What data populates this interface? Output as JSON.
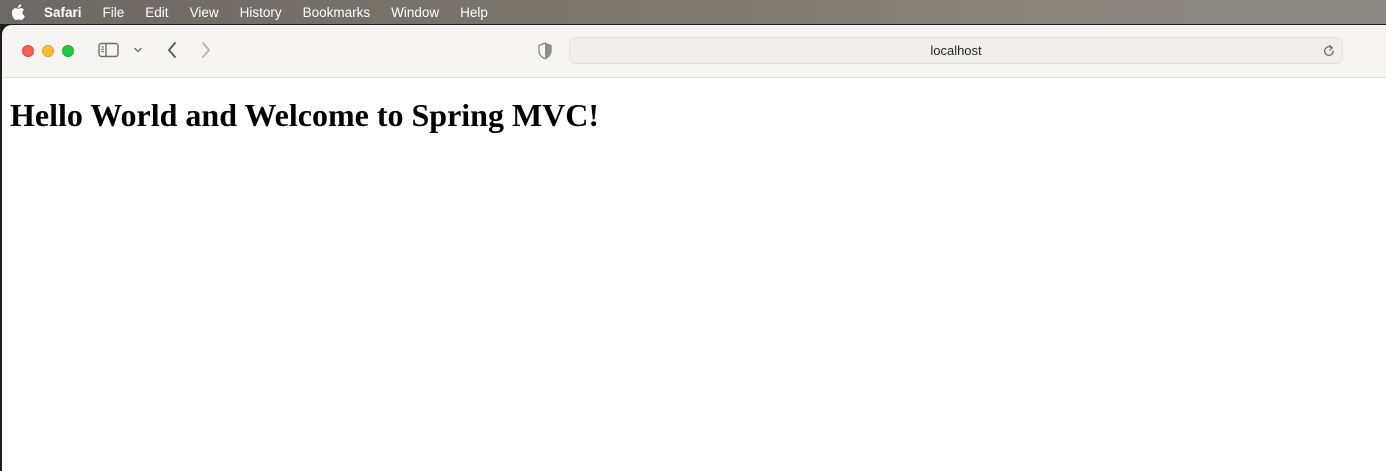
{
  "menubar": {
    "apple_icon": "apple-logo-icon",
    "items": [
      "Safari",
      "File",
      "Edit",
      "View",
      "History",
      "Bookmarks",
      "Window",
      "Help"
    ]
  },
  "toolbar": {
    "address": "localhost",
    "icons": {
      "sidebar": "sidebar-icon",
      "tab_menu": "chevron-down-icon",
      "back": "chevron-left-icon",
      "forward": "chevron-right-icon",
      "privacy": "shield-icon",
      "reload": "reload-icon"
    }
  },
  "page": {
    "heading": "Hello World and Welcome to Spring MVC!"
  },
  "colors": {
    "close": "#fe5f57",
    "minimize": "#febc2e",
    "maximize": "#28c840"
  }
}
